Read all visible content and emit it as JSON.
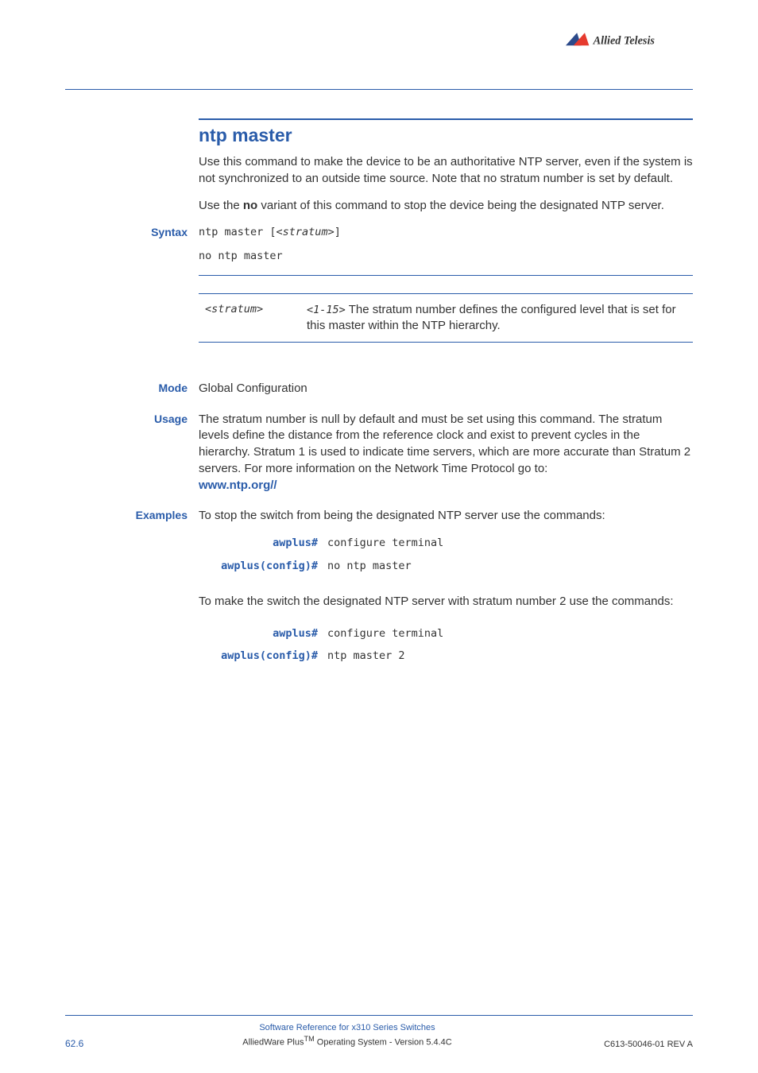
{
  "logo": {
    "brand": "Allied Telesis"
  },
  "title": "ntp master",
  "intro1": "Use this command to make the device to be an authoritative NTP server, even if the system is not synchronized to an outside time source. Note that no stratum number is set by default.",
  "intro2_pre": "Use the ",
  "intro2_bold": "no",
  "intro2_post": " variant of this command to stop the device being the designated NTP server.",
  "syntax": {
    "label": "Syntax",
    "line1_pre": "ntp master [<",
    "line1_param": "stratum",
    "line1_post": ">]",
    "line2": "no ntp master"
  },
  "param": {
    "name_pre": "<",
    "name": "stratum",
    "name_post": ">",
    "desc_code_pre": "<",
    "desc_code": "1-15",
    "desc_code_post": ">",
    "desc": " The stratum number defines the configured level that is set for this master within the NTP hierarchy."
  },
  "mode": {
    "label": "Mode",
    "text": "Global Configuration"
  },
  "usage": {
    "label": "Usage",
    "text": "The stratum number is null by default and must be set using this command. The stratum levels define the distance from the reference clock and exist to prevent cycles in the hierarchy. Stratum 1 is used to indicate time servers, which are more accurate than Stratum 2 servers. For more information on the Network Time Protocol go to:",
    "link": "www.ntp.org//"
  },
  "examples": {
    "label": "Examples",
    "intro1": "To stop the switch from being the designated NTP server use the commands:",
    "intro2": "To make the switch the designated NTP server with stratum number 2 use the commands:",
    "prompt1": "awplus#",
    "prompt2": "awplus(config)#",
    "cmd1a": "configure terminal",
    "cmd1b": "no ntp master",
    "cmd2a": "configure terminal",
    "cmd2b": "ntp master 2"
  },
  "footer": {
    "page": "62.6",
    "line1": "Software Reference for x310 Series Switches",
    "line2_pre": "AlliedWare Plus",
    "line2_tm": "TM",
    "line2_post": " Operating System  - Version 5.4.4C",
    "rev": "C613-50046-01 REV A"
  }
}
